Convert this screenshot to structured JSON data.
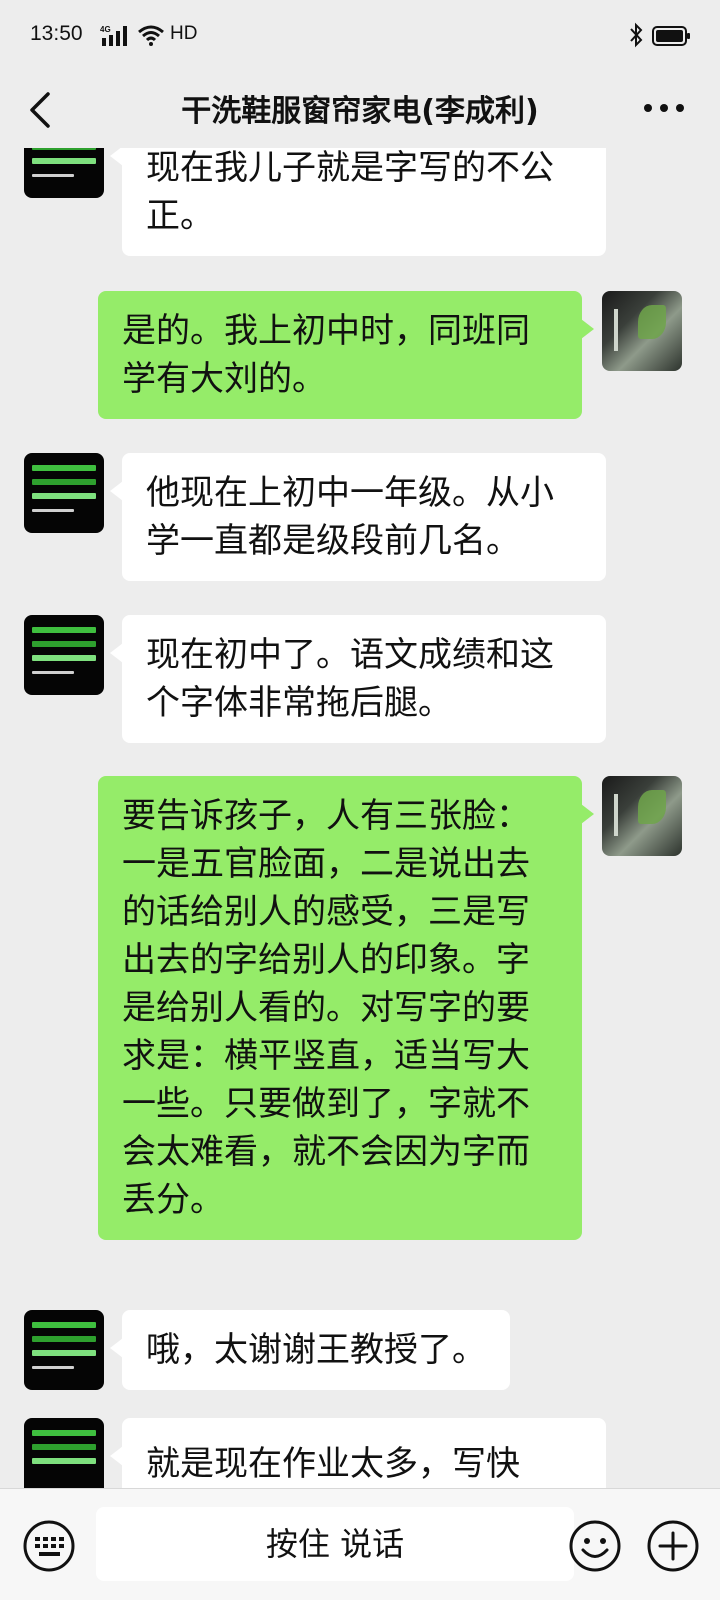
{
  "status_bar": {
    "time": "13:50",
    "signal_icon": "4g-signal-icon",
    "wifi_icon": "wifi-icon",
    "hd_label": "HD",
    "bluetooth_icon": "bluetooth-icon",
    "battery_icon": "battery-icon"
  },
  "nav": {
    "back_icon": "chevron-left-icon",
    "title": "干洗鞋服窗帘家电(李成利)",
    "more_icon": "more-dots-icon"
  },
  "messages": [
    {
      "side": "left",
      "text": "现在我儿子就是字写的不公正。"
    },
    {
      "side": "right",
      "text": "是的。我上初中时，同班同学有大刘的。"
    },
    {
      "side": "left",
      "text": "他现在上初中一年级。从小学一直都是级段前几名。"
    },
    {
      "side": "left",
      "text": "现在初中了。语文成绩和这个字体非常拖后腿。"
    },
    {
      "side": "right",
      "text": "要告诉孩子，人有三张脸：一是五官脸面，二是说出去的话给别人的感受，三是写出去的字给别人的印象。字是给别人看的。对写字的要求是：横平竖直，适当写大一些。只要做到了，字就不会太难看，就不会因为字而丢分。"
    },
    {
      "side": "left",
      "text": "哦，太谢谢王教授了。"
    },
    {
      "side": "left",
      "text": "就是现在作业太多，写快"
    }
  ],
  "input_bar": {
    "keyboard_icon": "keyboard-icon",
    "voice_label": "按住 说话",
    "emoji_icon": "emoji-icon",
    "plus_icon": "plus-circle-icon"
  },
  "colors": {
    "background": "#ededed",
    "bubble_self": "#95ec69",
    "bubble_other": "#ffffff"
  }
}
